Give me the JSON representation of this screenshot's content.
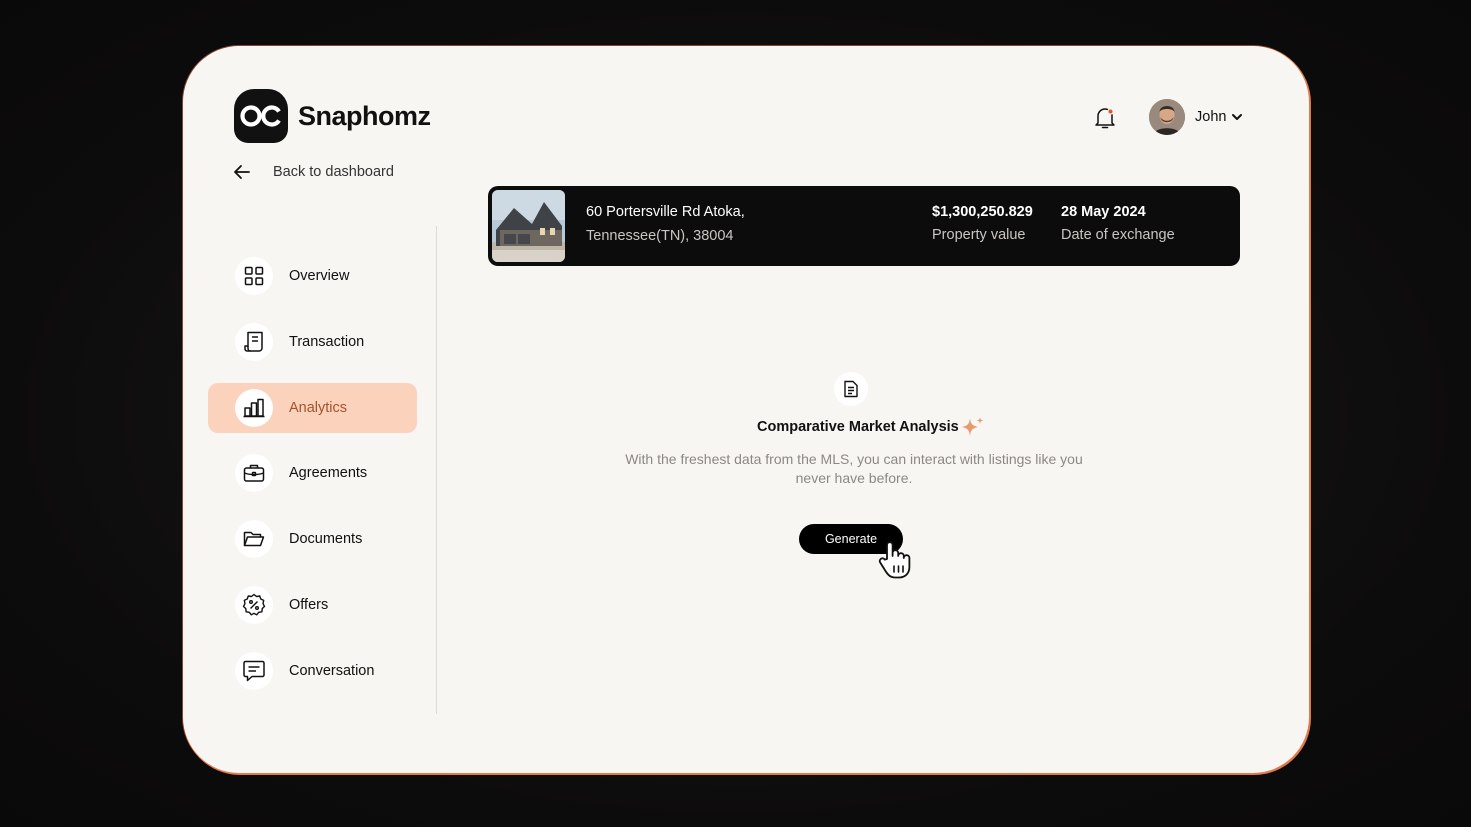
{
  "app": {
    "name": "Snaphomz"
  },
  "nav": {
    "back_label": "Back to dashboard",
    "items": [
      {
        "label": "Overview",
        "icon": "grid-icon",
        "active": false
      },
      {
        "label": "Transaction",
        "icon": "receipt-icon",
        "active": false
      },
      {
        "label": "Analytics",
        "icon": "bar-chart-icon",
        "active": true
      },
      {
        "label": "Agreements",
        "icon": "briefcase-icon",
        "active": false
      },
      {
        "label": "Documents",
        "icon": "folder-icon",
        "active": false
      },
      {
        "label": "Offers",
        "icon": "percent-badge-icon",
        "active": false
      },
      {
        "label": "Conversation",
        "icon": "message-icon",
        "active": false
      }
    ]
  },
  "header": {
    "user_name": "John",
    "notification_dot": true
  },
  "property": {
    "address_line1": "60 Portersville Rd Atoka,",
    "address_line2": "Tennessee(TN), 38004",
    "value": "$1,300,250.829",
    "value_label": "Property value",
    "date": "28 May 2024",
    "date_label": "Date of exchange"
  },
  "cma": {
    "title": "Comparative Market Analysis",
    "description": "With the freshest data from the MLS, you can interact with listings like you never have before.",
    "button_label": "Generate"
  },
  "colors": {
    "accent": "#fbd3bd",
    "accent_text": "#a3542a",
    "frame_border": "#e07a4a",
    "dark": "#0c0c0c",
    "background": "#f8f6f3"
  }
}
